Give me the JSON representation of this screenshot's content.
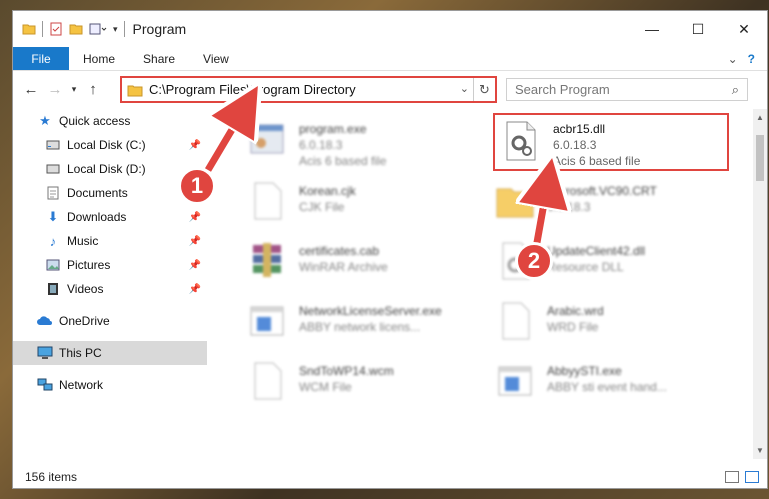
{
  "window": {
    "title": "Program",
    "controls": {
      "minimize": "—",
      "maximize": "☐",
      "close": "✕"
    }
  },
  "ribbon": {
    "tabs": [
      "File",
      "Home",
      "Share",
      "View"
    ]
  },
  "address": {
    "path": "C:\\Program Files\\Program Directory",
    "search_placeholder": "Search Program"
  },
  "sidebar": {
    "quick_access": "Quick access",
    "items": [
      {
        "label": "Local Disk (C:)",
        "icon": "drive-icon",
        "pinned": true
      },
      {
        "label": "Local Disk (D:)",
        "icon": "drive-icon",
        "pinned": false
      },
      {
        "label": "Documents",
        "icon": "documents-icon",
        "pinned": true
      },
      {
        "label": "Downloads",
        "icon": "download-icon",
        "pinned": true
      },
      {
        "label": "Music",
        "icon": "music-icon",
        "pinned": true
      },
      {
        "label": "Pictures",
        "icon": "pictures-icon",
        "pinned": true
      },
      {
        "label": "Videos",
        "icon": "videos-icon",
        "pinned": true
      }
    ],
    "onedrive": "OneDrive",
    "this_pc": "This PC",
    "network": "Network"
  },
  "files": [
    {
      "name": "program.exe",
      "line2": "6.0.18.3",
      "line3": "Acis 6 based file",
      "icon": "exe-icon",
      "blurred": true
    },
    {
      "name": "acbr15.dll",
      "line2": "6.0.18.3",
      "line3": "Acis 6 based file",
      "icon": "dll-gear-icon",
      "blurred": false,
      "highlighted": true
    },
    {
      "name": "Korean.cjk",
      "line2": "CJK File",
      "line3": "",
      "icon": "blank-file-icon",
      "blurred": true
    },
    {
      "name": "Microsoft.VC90.CRT",
      "line2": "6.0.18.3",
      "line3": "",
      "icon": "folder-icon",
      "blurred": true
    },
    {
      "name": "certificates.cab",
      "line2": "WinRAR Archive",
      "line3": "",
      "icon": "winrar-icon",
      "blurred": true
    },
    {
      "name": "UpdateClient42.dll",
      "line2": "Resource DLL",
      "line3": "",
      "icon": "dll-icon",
      "blurred": true
    },
    {
      "name": "NetworkLicenseServer.exe",
      "line2": "ABBY network licens...",
      "line3": "",
      "icon": "exe-window-icon",
      "blurred": true
    },
    {
      "name": "Arabic.wrd",
      "line2": "WRD File",
      "line3": "",
      "icon": "blank-file-icon",
      "blurred": true
    },
    {
      "name": "SndToWP14.wcm",
      "line2": "WCM File",
      "line3": "",
      "icon": "blank-file-icon",
      "blurred": true
    },
    {
      "name": "AbbyySTI.exe",
      "line2": "ABBY sti event hand...",
      "line3": "",
      "icon": "exe-window-icon",
      "blurred": true
    }
  ],
  "status": {
    "items": "156 items"
  },
  "callouts": [
    "1",
    "2"
  ],
  "colors": {
    "accent": "#1979ca",
    "highlight": "#e0453f"
  }
}
